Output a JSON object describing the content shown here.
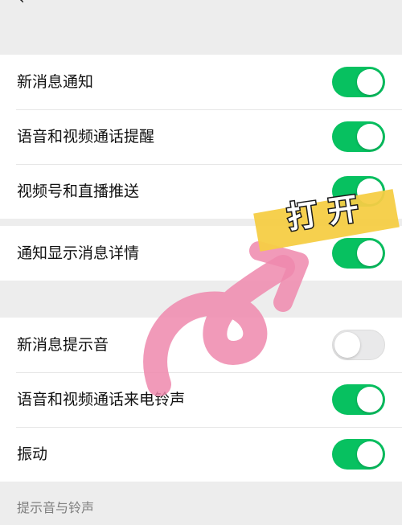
{
  "header": {
    "back_icon": "chevron-left-icon",
    "title": ""
  },
  "group1": [
    {
      "label": "新消息通知",
      "on": true
    },
    {
      "label": "语音和视频通话提醒",
      "on": true
    },
    {
      "label": "视频号和直播推送",
      "on": true
    }
  ],
  "group2": [
    {
      "label": "通知显示消息详情",
      "on": true
    }
  ],
  "group3": [
    {
      "label": "新消息提示音",
      "on": false
    },
    {
      "label": "语音和视频通话来电铃声",
      "on": true
    },
    {
      "label": "振动",
      "on": true
    }
  ],
  "section_label": "提示音与铃声",
  "annotation": {
    "sticker_text": "打 开",
    "sticker_color": "#f5cd45",
    "arrow_color": "#ef88ad"
  },
  "colors": {
    "toggle_on": "#07c160",
    "toggle_off": "#e9e9ea"
  }
}
